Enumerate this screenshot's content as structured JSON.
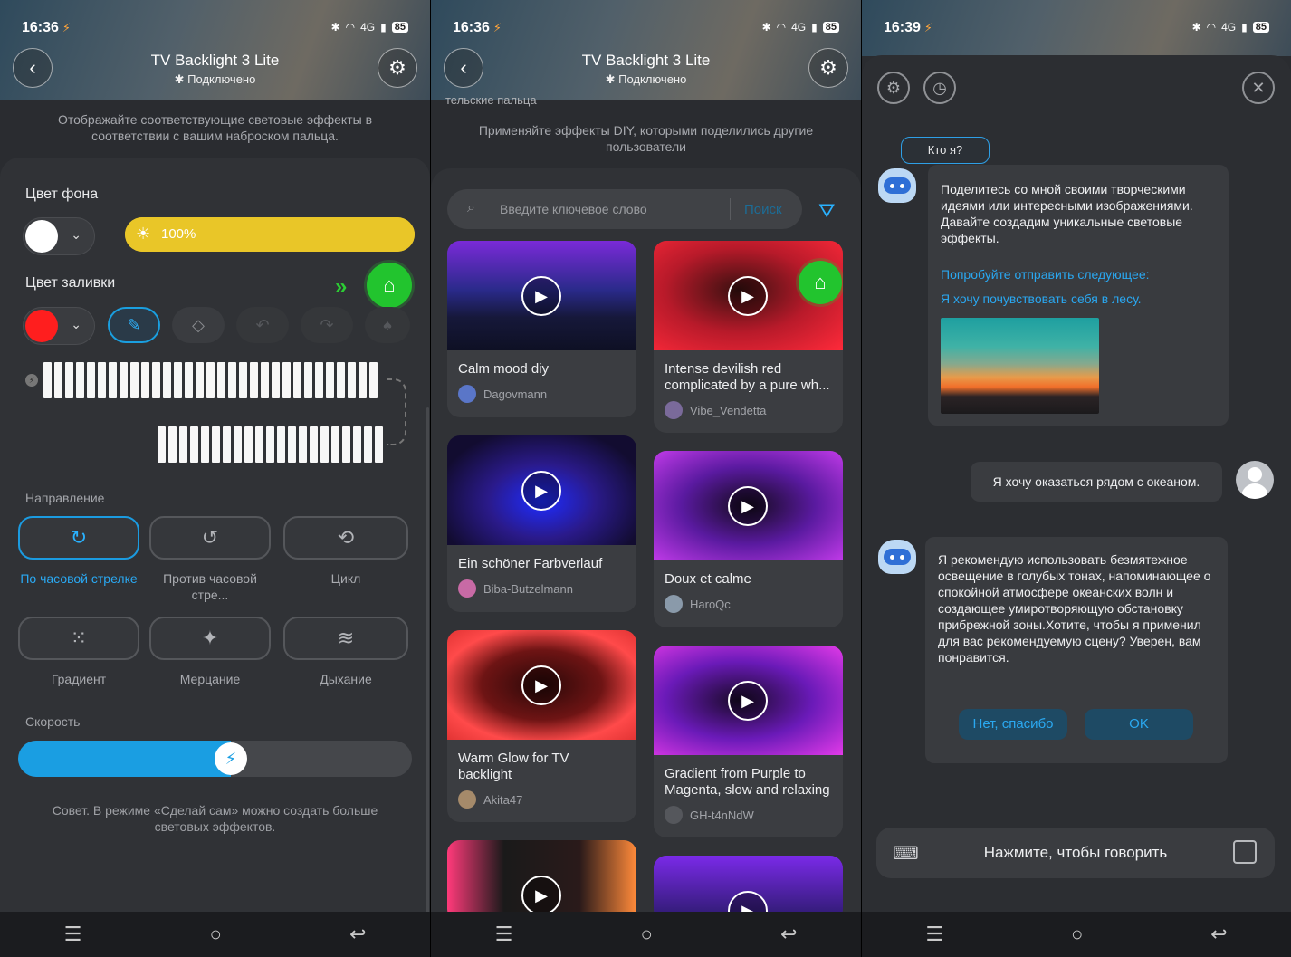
{
  "status1": {
    "time": "16:36",
    "battery": "85",
    "net": "4G"
  },
  "status2": {
    "time": "16:36",
    "battery": "85",
    "net": "4G"
  },
  "status3": {
    "time": "16:39",
    "battery": "85",
    "net": "4G"
  },
  "header": {
    "title": "TV Backlight 3 Lite",
    "subtitle": "Подключено"
  },
  "panel1": {
    "desc": "Отображайте соответствующие световые эффекты в соответствии с вашим наброском пальца.",
    "bg_color_label": "Цвет фона",
    "brightness": "100%",
    "brightness_value": 100,
    "fill_color_label": "Цвет заливки",
    "direction_label": "Направление",
    "modes": [
      {
        "label": "По часовой стрелке",
        "icon": "clockwise-icon"
      },
      {
        "label": "Против часовой стре...",
        "icon": "counterclockwise-icon"
      },
      {
        "label": "Цикл",
        "icon": "cycle-icon"
      },
      {
        "label": "Градиент",
        "icon": "gradient-icon"
      },
      {
        "label": "Мерцание",
        "icon": "sparkle-icon"
      },
      {
        "label": "Дыхание",
        "icon": "breathing-icon"
      }
    ],
    "speed_label": "Скорость",
    "speed_value": 0.54,
    "tip": "Совет. В режиме «Сделай сам» можно создать больше световых эффектов.",
    "colors": {
      "background": "#ffffff",
      "fill": "#ff1e1e",
      "accent": "#1a9ee2"
    }
  },
  "panel2": {
    "clipped_top": "тельские        пальца",
    "desc": "Применяйте эффекты DIY, которыми поделились другие пользователи",
    "search_placeholder": "Введите ключевое слово",
    "search_button": "Поиск",
    "tiles": [
      {
        "title": "Calm mood diy",
        "user": "Dagovmann"
      },
      {
        "title": "Intense devilish red complicated by a pure wh...",
        "user": "Vibe_Vendetta"
      },
      {
        "title": "Ein schöner Farbverlauf",
        "user": "Biba-Butzelmann"
      },
      {
        "title": "Doux et calme",
        "user": "HaroQc"
      },
      {
        "title": "Warm Glow for TV backlight",
        "user": "Akita47"
      },
      {
        "title": "Gradient from Purple to Magenta, slow and relaxing",
        "user": "GH-t4nNdW"
      }
    ]
  },
  "panel3": {
    "who_am_i": "Кто я?",
    "bot_intro": "Поделитесь со мной своими творческими идеями или интересными изображениями. Давайте создадим уникальные световые эффекты.",
    "try_send": "Попробуйте отправить следующее:",
    "suggestion": "Я хочу почувствовать себя в лесу.",
    "user_message": "Я хочу оказаться рядом с океаном.",
    "bot_reply": "Я рекомендую использовать безмятежное освещение в голубых тонах, напоминающее о спокойной атмосфере океанских волн и создающее умиротворяющую обстановку прибрежной зоны.Хотите, чтобы я применил для вас рекомендуемую сцену? Уверен, вам понравится.",
    "no_button": "Нет, спасибо",
    "ok_button": "OK",
    "talk": "Нажмите, чтобы говорить"
  }
}
